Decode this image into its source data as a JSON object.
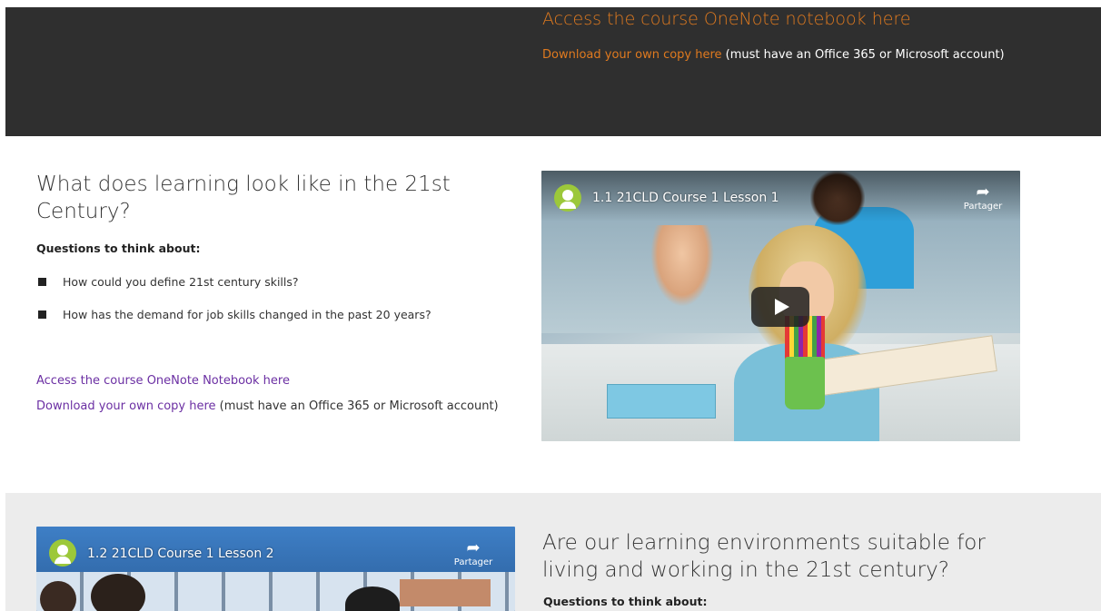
{
  "banner": {
    "title": "Access the course OneNote notebook here",
    "download_link": "Download your own copy here",
    "download_note": " (must have an Office 365 or Microsoft account)"
  },
  "section1": {
    "heading": "What does learning look like in the 21st Century?",
    "questions_label": "Questions to think about:",
    "questions": [
      "How could you define 21st century skills?",
      "How has the demand for job skills changed in the past 20 years?"
    ],
    "notebook_link": "Access the course OneNote Notebook here",
    "download_link": "Download your own copy here",
    "download_note": " (must have an Office 365 or Microsoft account)",
    "video": {
      "title": "1.1 21CLD Course 1 Lesson 1",
      "share_label": "Partager"
    }
  },
  "section2": {
    "heading": "Are our learning environments suitable for living and working in the 21st century?",
    "questions_label": "Questions to think about:",
    "video": {
      "title": "1.2 21CLD Course 1 Lesson 2",
      "share_label": "Partager"
    }
  },
  "colors": {
    "banner_bg": "#2f2f2f",
    "banner_link": "#e07a1f",
    "link_purple": "#6b2fa3",
    "section2_bg": "#ececec",
    "youtube_avatar": "#9cc83a"
  },
  "icons": [
    "share-arrow-icon",
    "play-icon",
    "channel-avatar-icon",
    "bullet-square-icon"
  ]
}
